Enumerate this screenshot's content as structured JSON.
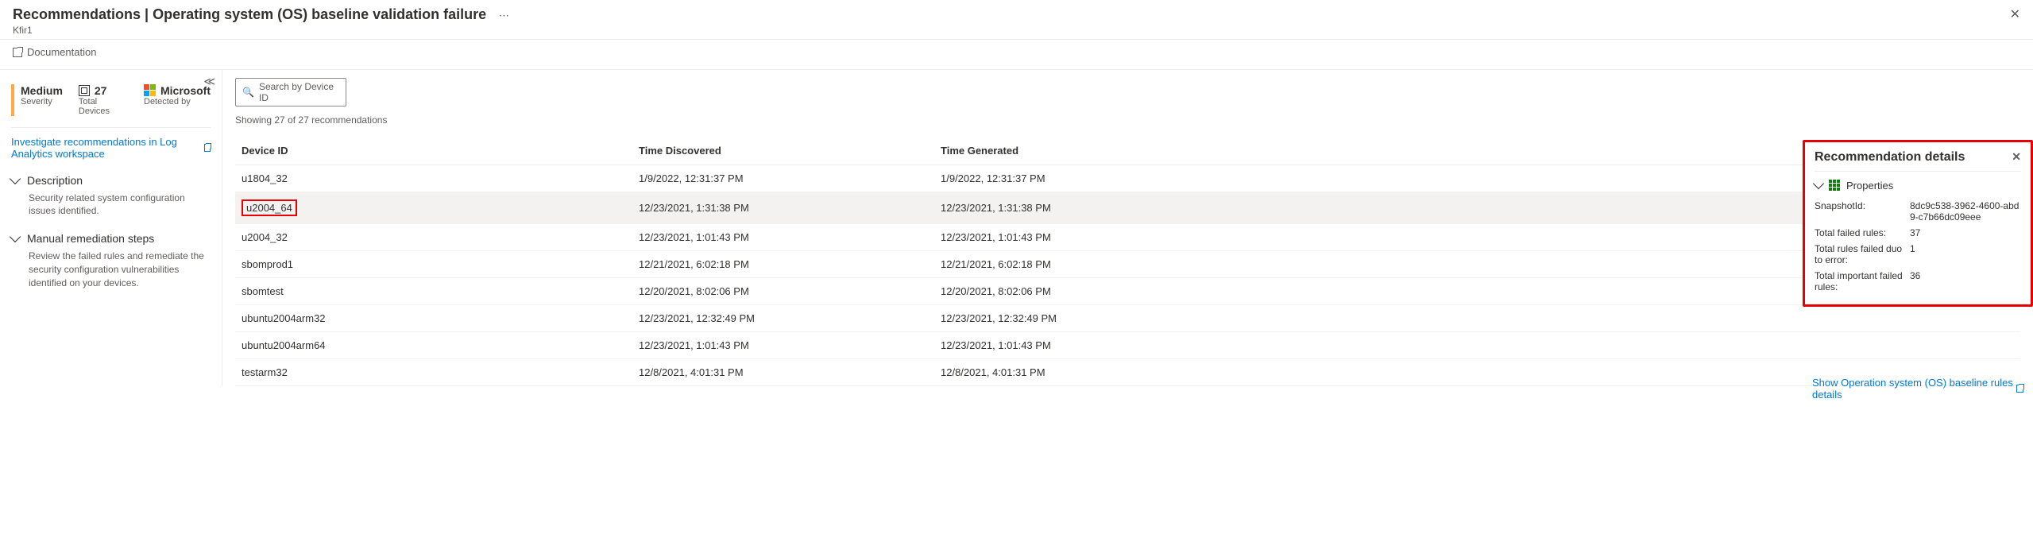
{
  "header": {
    "title": "Recommendations | Operating system (OS) baseline validation failure",
    "breadcrumb": "Kfir1",
    "documentation_label": "Documentation"
  },
  "summary": {
    "severity_value": "Medium",
    "severity_label": "Severity",
    "devices_value": "27",
    "devices_label": "Total Devices",
    "detected_value": "Microsoft",
    "detected_label": "Detected by",
    "investigate_link": "Investigate recommendations in Log Analytics workspace"
  },
  "description": {
    "title": "Description",
    "body": "Security related system configuration issues identified."
  },
  "remediation": {
    "title": "Manual remediation steps",
    "body": "Review the failed rules and remediate the security configuration vulnerabilities identified on your devices."
  },
  "search": {
    "placeholder": "Search by Device ID"
  },
  "result_count": "Showing 27 of 27 recommendations",
  "columns": {
    "id": "Device ID",
    "discovered": "Time Discovered",
    "generated": "Time Generated"
  },
  "rows": [
    {
      "id": "u1804_32",
      "discovered": "1/9/2022, 12:31:37 PM",
      "generated": "1/9/2022, 12:31:37 PM",
      "selected": false,
      "highlight": false
    },
    {
      "id": "u2004_64",
      "discovered": "12/23/2021, 1:31:38 PM",
      "generated": "12/23/2021, 1:31:38 PM",
      "selected": true,
      "highlight": true
    },
    {
      "id": "u2004_32",
      "discovered": "12/23/2021, 1:01:43 PM",
      "generated": "12/23/2021, 1:01:43 PM",
      "selected": false,
      "highlight": false
    },
    {
      "id": "sbomprod1",
      "discovered": "12/21/2021, 6:02:18 PM",
      "generated": "12/21/2021, 6:02:18 PM",
      "selected": false,
      "highlight": false
    },
    {
      "id": "sbomtest",
      "discovered": "12/20/2021, 8:02:06 PM",
      "generated": "12/20/2021, 8:02:06 PM",
      "selected": false,
      "highlight": false
    },
    {
      "id": "ubuntu2004arm32",
      "discovered": "12/23/2021, 12:32:49 PM",
      "generated": "12/23/2021, 12:32:49 PM",
      "selected": false,
      "highlight": false
    },
    {
      "id": "ubuntu2004arm64",
      "discovered": "12/23/2021, 1:01:43 PM",
      "generated": "12/23/2021, 1:01:43 PM",
      "selected": false,
      "highlight": false
    },
    {
      "id": "testarm32",
      "discovered": "12/8/2021, 4:01:31 PM",
      "generated": "12/8/2021, 4:01:31 PM",
      "selected": false,
      "highlight": false
    }
  ],
  "panel": {
    "title": "Recommendation details",
    "section": "Properties",
    "props": [
      {
        "label": "SnapshotId:",
        "value": "8dc9c538-3962-4600-abd9-c7b66dc09eee"
      },
      {
        "label": "Total failed rules:",
        "value": "37"
      },
      {
        "label": "Total rules failed duo to error:",
        "value": "1"
      },
      {
        "label": "Total important failed rules:",
        "value": "36"
      }
    ],
    "link": "Show Operation system (OS) baseline rules details"
  }
}
